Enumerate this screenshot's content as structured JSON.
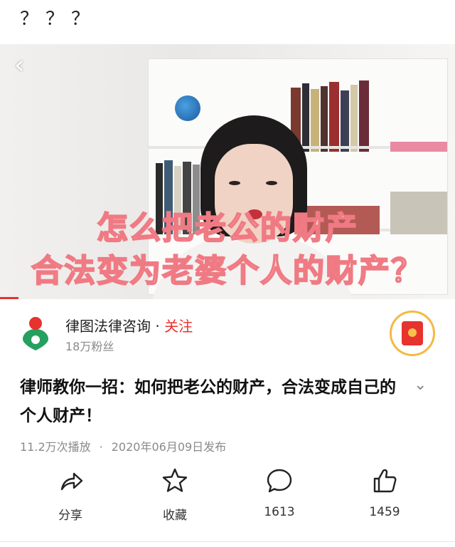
{
  "top_caption": "？？？",
  "video": {
    "overlay_line1": "怎么把老公的财产",
    "overlay_line2": "合法变为老婆个人的财产？",
    "back_glyph": "‹",
    "progress_fraction": 0.04
  },
  "channel": {
    "name": "律图法律咨询",
    "separator": " · ",
    "follow_label": "关注",
    "fans": "18万粉丝"
  },
  "title_text": "律师教你一招：如何把老公的财产，合法变成自己的个人财产！",
  "meta": {
    "views": "11.2万次播放",
    "dot": "·",
    "date": "2020年06月09日发布"
  },
  "actions": [
    {
      "icon": "share-icon",
      "label": "分享"
    },
    {
      "icon": "star-icon",
      "label": "收藏"
    },
    {
      "icon": "comment-icon",
      "label": "1613"
    },
    {
      "icon": "thumbs-up-icon",
      "label": "1459"
    }
  ],
  "colors": {
    "accent": "#e7322e",
    "overlay_text": "#fbd7d7",
    "overlay_stroke": "#f07a83"
  }
}
